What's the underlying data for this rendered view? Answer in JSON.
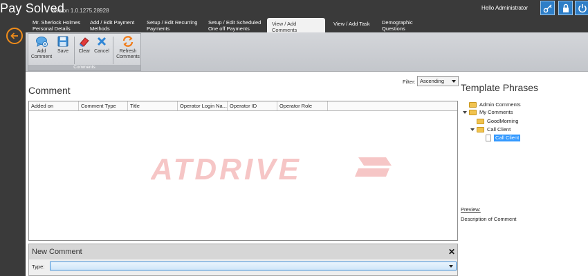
{
  "app": {
    "title": "Pay Solved",
    "version": "Version 1.0.1275.28928",
    "greeting": "Hello Administrator"
  },
  "header_buttons": [
    {
      "icon": "key-icon"
    },
    {
      "icon": "lock-icon"
    },
    {
      "icon": "power-icon"
    }
  ],
  "tabs": [
    {
      "line1": "Mr. Sherlock Holmes",
      "line2": "Personal Details"
    },
    {
      "line1": "Add / Edit Payment",
      "line2": "Methods"
    },
    {
      "line1": "Setup / Edit Recurring",
      "line2": "Payments"
    },
    {
      "line1": "Setup / Edit Scheduled",
      "line2": "One off Payments"
    },
    {
      "line1": "View / Add Comments",
      "line2": ""
    },
    {
      "line1": "View / Add Task",
      "line2": ""
    },
    {
      "line1": "Demographic",
      "line2": "Questions"
    }
  ],
  "active_tab": "View / Add Comments",
  "ribbon": {
    "group_label": "Comments",
    "buttons": [
      {
        "line1": "Add",
        "line2": "Comment",
        "icon": "add-comment-icon"
      },
      {
        "line1": "Save",
        "line2": "",
        "icon": "save-icon"
      },
      {
        "line1": "Clear",
        "line2": "",
        "icon": "eraser-icon"
      },
      {
        "line1": "Cancel",
        "line2": "",
        "icon": "cancel-icon"
      },
      {
        "line1": "Refresh",
        "line2": "Comments",
        "icon": "refresh-icon"
      }
    ]
  },
  "comment": {
    "title": "Comment",
    "filter_label": "Filter:",
    "filter_value": "Ascending",
    "columns": [
      "Added on",
      "Comment Type",
      "Title",
      "Operator Login Na...",
      "Operator ID",
      "Operator Role"
    ]
  },
  "watermark": "ATDRIVE",
  "template_phrases": {
    "title": "Template Phrases",
    "items": [
      {
        "label": "Admin Comments"
      },
      {
        "label": "My Comments"
      },
      {
        "label": "GoodMorning"
      },
      {
        "label": "Call Client"
      },
      {
        "label": "Call Client"
      }
    ],
    "preview_label": "Preview:",
    "preview_text": "Description of Comment"
  },
  "new_comment": {
    "title": "New Comment",
    "close": "✕",
    "type_label": "Type:",
    "type_value": ""
  },
  "colors": {
    "topbar": "#3a3a3a",
    "accent_orange": "#f08c1a",
    "button_blue": "#2e7ec7",
    "selection": "#3399ff"
  }
}
